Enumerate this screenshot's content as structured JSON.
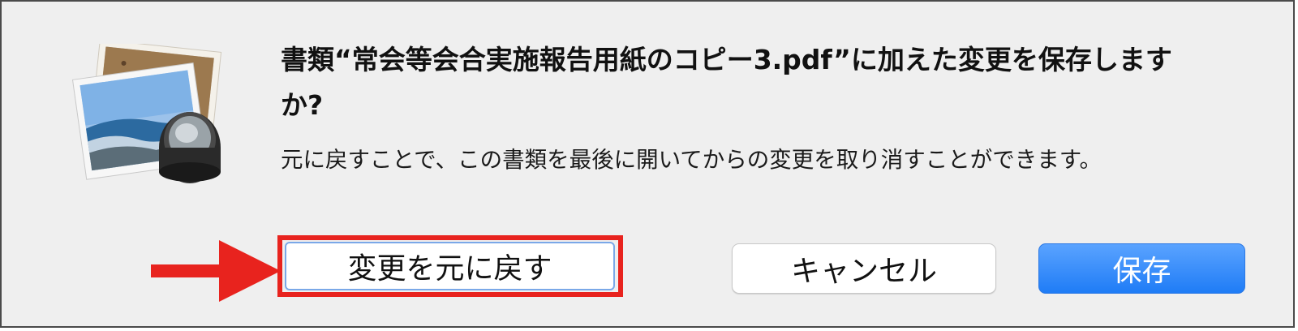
{
  "dialog": {
    "title": "書類“常会等会合実施報告用紙のコピー3.pdf”に加えた変更を保存しますか?",
    "message": "元に戻すことで、この書類を最後に開いてからの変更を取り消すことができます。",
    "buttons": {
      "revert": "変更を元に戻す",
      "cancel": "キャンセル",
      "save": "保存"
    },
    "icon": "preview-app-icon"
  },
  "annotation": {
    "arrow_icon": "red-arrow-icon",
    "highlight_color": "#e8231e"
  },
  "colors": {
    "accent": "#1f7cf6",
    "dialog_bg": "#efefef"
  }
}
